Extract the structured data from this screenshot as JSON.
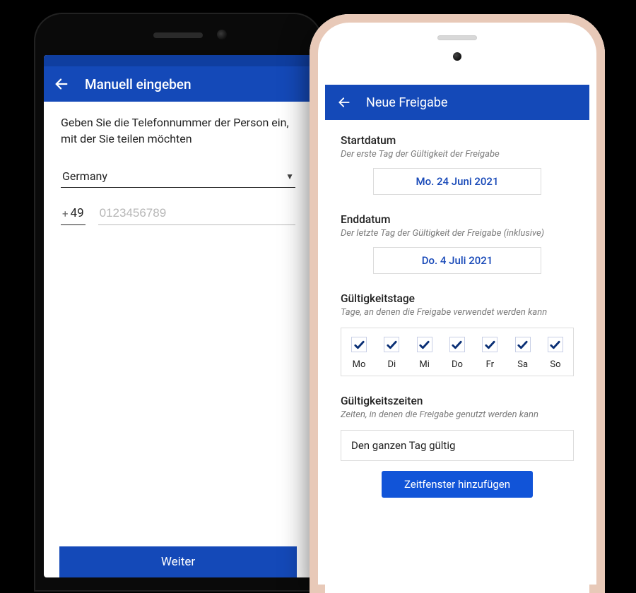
{
  "android": {
    "title": "Manuell eingeben",
    "instruction": "Geben Sie die Telefonnummer der Person ein, mit der Sie teilen möchten",
    "country": "Germany",
    "dial_code": "49",
    "phone_placeholder": "0123456789",
    "continue_label": "Weiter"
  },
  "ios": {
    "title": "Neue Freigabe",
    "start": {
      "label": "Startdatum",
      "sub": "Der erste Tag der Gültigkeit der Freigabe",
      "value": "Mo. 24 Juni 2021"
    },
    "end": {
      "label": "Enddatum",
      "sub": "Der letzte Tag der Gültigkeit der Freigabe (inklusive)",
      "value": "Do. 4 Juli 2021"
    },
    "days": {
      "label": "Gültigkeitstage",
      "sub": "Tage, an denen die Freigabe verwendet werden kann",
      "items": [
        "Mo",
        "Di",
        "Mi",
        "Do",
        "Fr",
        "Sa",
        "So"
      ]
    },
    "times": {
      "label": "Gültigkeitszeiten",
      "sub": "Zeiten, in denen die Freigabe genutzt werden kann",
      "value": "Den ganzen Tag gültig",
      "add_label": "Zeitfenster hinzufügen"
    }
  },
  "colors": {
    "brand": "#1449b8"
  }
}
